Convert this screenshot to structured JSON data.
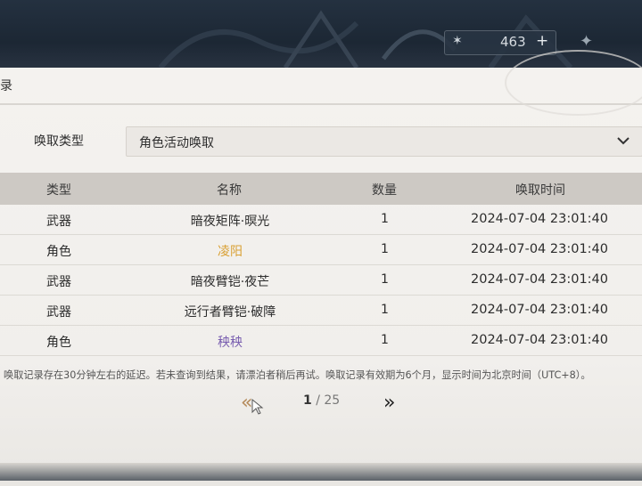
{
  "currency": {
    "icon": "star-icon",
    "amount": "463",
    "plus": "+"
  },
  "panel": {
    "title_fragment": "录"
  },
  "filter": {
    "label": "唤取类型",
    "selected": "角色活动唤取"
  },
  "table": {
    "headers": [
      "类型",
      "名称",
      "数量",
      "唤取时间"
    ],
    "rows": [
      {
        "type": "武器",
        "name": "暗夜矩阵·暝光",
        "qty": "1",
        "time": "2024-07-04 23:01:40",
        "name_color": "#2c2c2c"
      },
      {
        "type": "角色",
        "name": "凌阳",
        "qty": "1",
        "time": "2024-07-04 23:01:40",
        "name_color": "#d9a034"
      },
      {
        "type": "武器",
        "name": "暗夜臂铠·夜芒",
        "qty": "1",
        "time": "2024-07-04 23:01:40",
        "name_color": "#2c2c2c"
      },
      {
        "type": "武器",
        "name": "远行者臂铠·破障",
        "qty": "1",
        "time": "2024-07-04 23:01:40",
        "name_color": "#2c2c2c"
      },
      {
        "type": "角色",
        "name": "秧秧",
        "qty": "1",
        "time": "2024-07-04 23:01:40",
        "name_color": "#7a5fb0"
      }
    ]
  },
  "note": "唤取记录存在30分钟左右的延迟。若未查询到结果，请漂泊者稍后再试。唤取记录有效期为6个月，显示时间为北京时间（UTC+8）。",
  "pager": {
    "prev": "«",
    "current": "1",
    "separator": " / ",
    "total": "25",
    "next": "»"
  }
}
